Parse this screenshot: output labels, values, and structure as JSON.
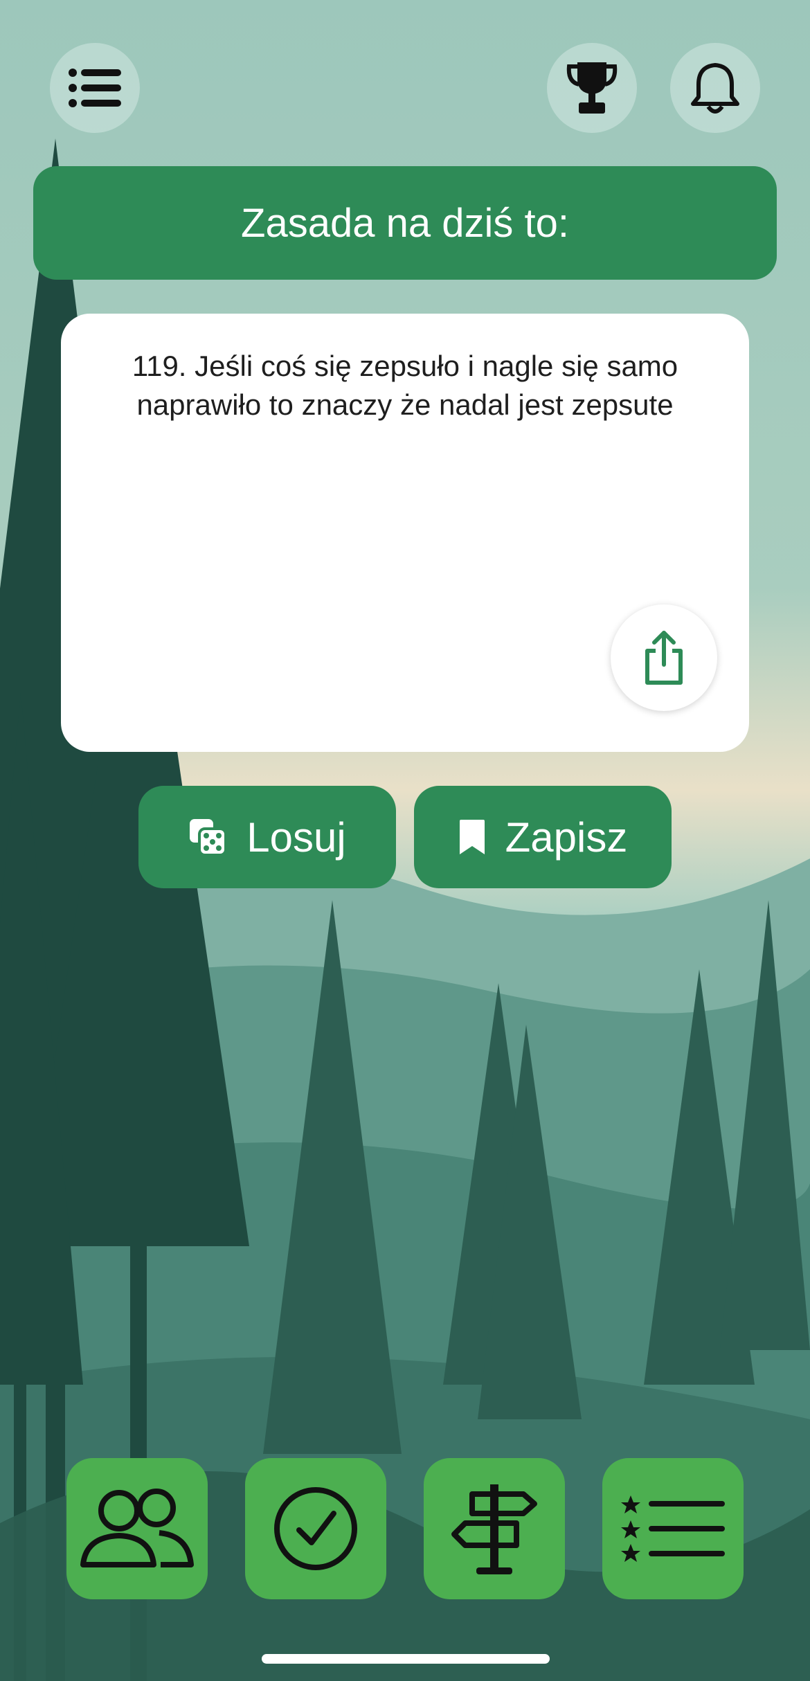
{
  "header": {
    "menu_icon": "list-menu-icon",
    "trophy_icon": "trophy-icon",
    "bell_icon": "bell-icon"
  },
  "banner": {
    "title": "Zasada na dziś to:"
  },
  "rule_card": {
    "text": "119. Jeśli coś się zepsuło i nagle się samo naprawiło to znaczy że nadal jest zepsute",
    "share_icon": "share-icon"
  },
  "actions": {
    "random_label": "Losuj",
    "random_icon": "dice-icon",
    "save_label": "Zapisz",
    "save_icon": "bookmark-icon"
  },
  "bottom_nav": {
    "items": [
      {
        "icon": "people-icon"
      },
      {
        "icon": "check-circle-icon"
      },
      {
        "icon": "signpost-icon"
      },
      {
        "icon": "starred-list-icon"
      }
    ]
  },
  "colors": {
    "primary_green": "#2e8b57",
    "tile_green": "#4caf50",
    "background_teal": "#9cc6ba"
  }
}
